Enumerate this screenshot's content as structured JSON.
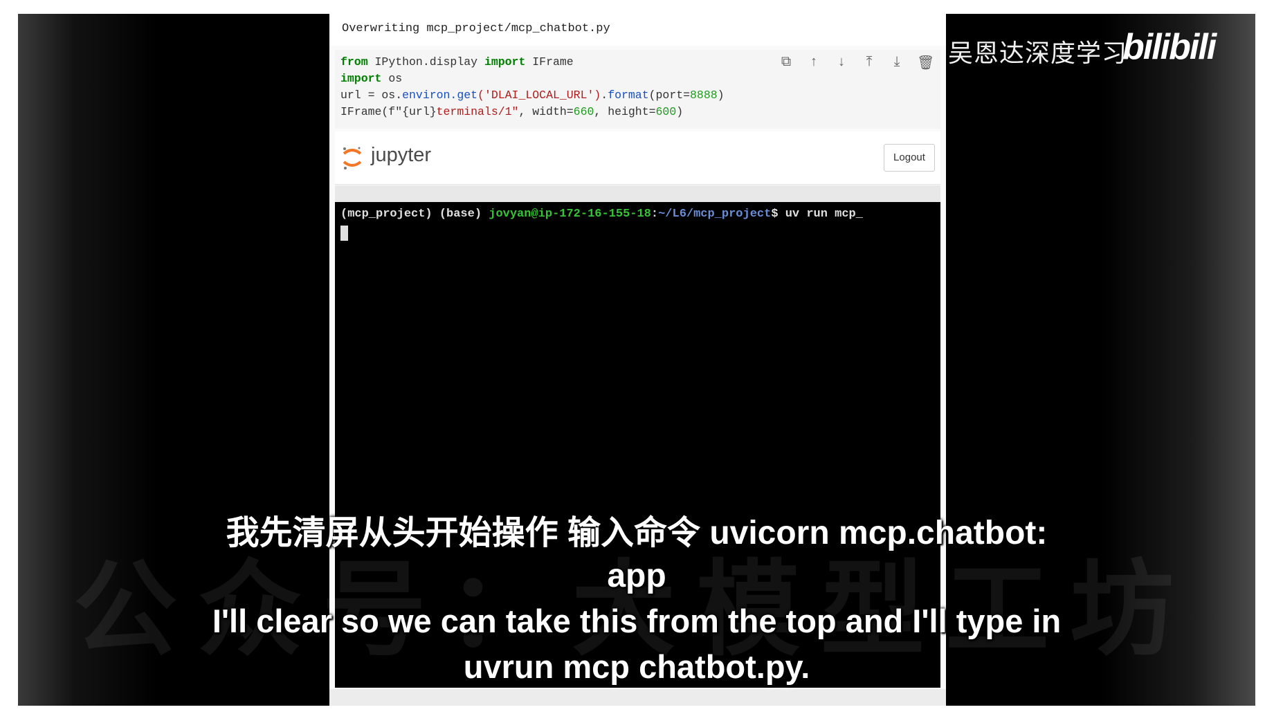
{
  "output_text": "Overwriting mcp_project/mcp_chatbot.py",
  "code": {
    "line1": {
      "kw1": "from",
      "module": " IPython.display ",
      "kw2": "import",
      "name": " IFrame"
    },
    "line2": {
      "kw": "import",
      "name": " os"
    },
    "line3": {
      "pre": "url = os.",
      "attr1": "environ.get",
      "str": "('DLAI_LOCAL_URL')",
      "dot": ".",
      "attr2": "format",
      "args": "(port=",
      "num": "8888",
      "close": ")"
    },
    "line4": {
      "pre": "IFrame(f\"{url}",
      "str": "terminals/1\"",
      "mid": ", width=",
      "w": "660",
      "mid2": ", height=",
      "h": "600",
      "close": ")"
    }
  },
  "cell_tools": [
    "copy-icon",
    "move-up-icon",
    "move-down-icon",
    "insert-above-icon",
    "insert-below-icon",
    "delete-icon"
  ],
  "jupyter": {
    "logo_text": "jupyter",
    "logout_label": "Logout"
  },
  "terminal": {
    "prefix": "(mcp_project) (base) ",
    "user_host": "jovyan@ip-172-16-155-18",
    "path_sep": ":",
    "path": "~/L6/mcp_project",
    "prompt": "$ uv run mcp_"
  },
  "channel_name": "吴恩达深度学习",
  "logo_text": "bilibili",
  "watermark": "公众号：大模型工坊",
  "subtitles": {
    "zh_line1": "我先清屏从头开始操作  输入命令  uvicorn mcp.chatbot:",
    "zh_line2": "app",
    "en_line1": "I'll clear so we can take this from the top and I'll type in",
    "en_line2": "uvrun mcp chatbot.py."
  },
  "colors": {
    "keyword": "#008000",
    "string": "#b01c1c",
    "number": "#1f9a1f",
    "terminal_user": "#35c435",
    "terminal_path": "#6a8dd8",
    "jupyter_orange": "#f37726"
  }
}
